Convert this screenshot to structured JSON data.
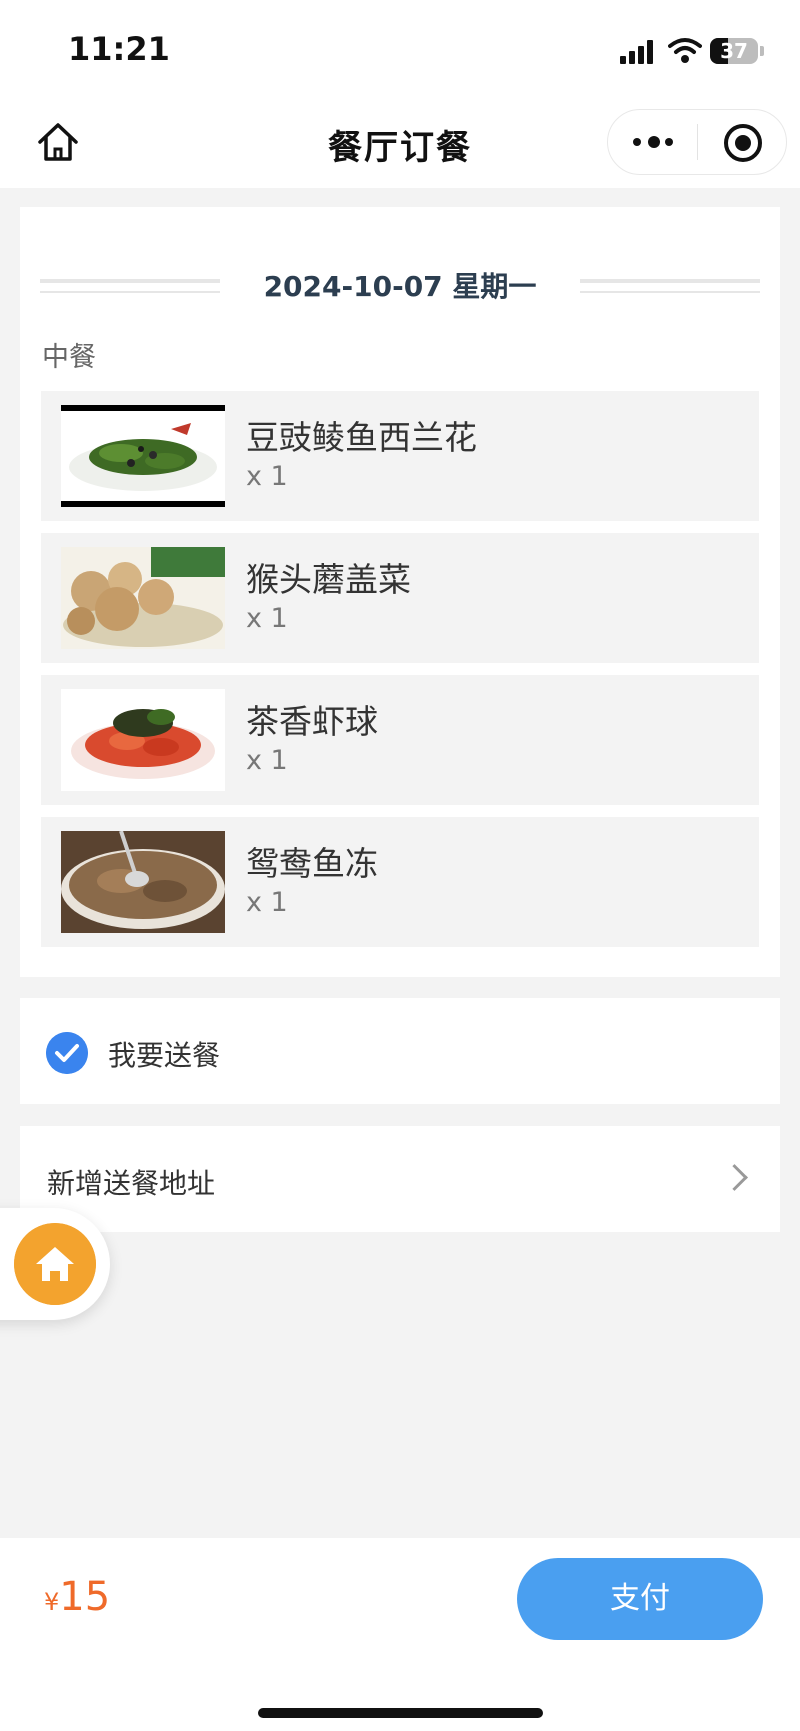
{
  "status_bar": {
    "time": "11:21",
    "battery": "37",
    "battery_level": 0.37
  },
  "nav": {
    "title": "餐厅订餐"
  },
  "order": {
    "date": "2024-10-07 星期一",
    "meal": "中餐",
    "dishes": [
      {
        "name": "豆豉鲮鱼西兰花",
        "qty": "x 1"
      },
      {
        "name": "猴头蘑盖菜",
        "qty": "x 1"
      },
      {
        "name": "茶香虾球",
        "qty": "x 1"
      },
      {
        "name": "鸳鸯鱼冻",
        "qty": "x 1"
      }
    ]
  },
  "delivery": {
    "checkbox_label": "我要送餐",
    "checked": true
  },
  "address": {
    "label": "新增送餐地址"
  },
  "footer": {
    "currency": "¥",
    "price": "15",
    "pay_label": "支付"
  },
  "colors": {
    "accent": "#4a9ff0",
    "price": "#ef6a2a",
    "check": "#3a84ee",
    "float_home": "#f3a32e"
  }
}
